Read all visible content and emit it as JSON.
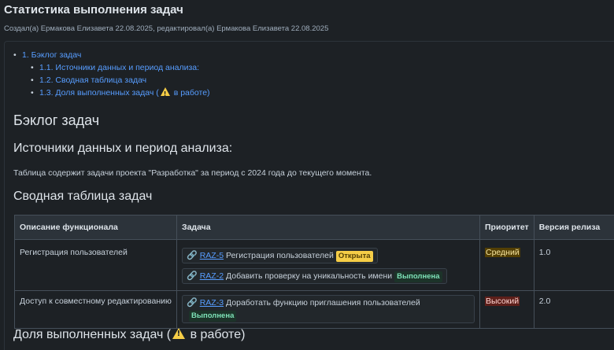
{
  "page": {
    "title": "Статистика выполнения задач",
    "meta": "Создал(а) Ермакова Елизавета 22.08.2025, редактировал(а) Ермакова Елизавета 22.08.2025"
  },
  "toc": {
    "main": "1. Бэклог задач",
    "items": [
      "1.1. Источники данных и период анализа:",
      "1.2. Сводная таблица задач",
      "1.3. Доля выполненных задач ("
    ],
    "item3_suffix": "в работе)"
  },
  "headings": {
    "backlog": "Бэклог задач",
    "sources": "Источники данных и период анализа:",
    "summary": "Сводная таблица задач",
    "share_prefix": "Доля выполненных задач (",
    "share_suffix": "в работе)"
  },
  "paragraph": "Таблица содержит задачи проекта \"Разработка\" за период с 2024 года до текущего момента.",
  "table": {
    "headers": [
      "Описание функционала",
      "Задача",
      "Приоритет",
      "Версия релиза"
    ],
    "rows": [
      {
        "description": "Регистрация пользователей",
        "tasks": [
          {
            "key": "RAZ-5",
            "title": "Регистрация пользователей",
            "status": "Открыта"
          },
          {
            "key": "RAZ-2",
            "title": "Добавить проверку на уникальность имени",
            "status": "Выполнена"
          }
        ],
        "priority": "Средний",
        "version": "1.0"
      },
      {
        "description": "Доступ к совместному редактированию",
        "tasks": [
          {
            "key": "RAZ-3",
            "title": "Доработать функцию приглашения пользователей",
            "status": "Выполнена"
          }
        ],
        "priority": "Высокий",
        "version": "2.0"
      }
    ]
  },
  "icons": {
    "warning": "warning-icon",
    "link": "link-icon"
  },
  "colors": {
    "background": "#1d2125",
    "link": "#579dff",
    "status_open": "#f5cd47",
    "status_done": "#1c3329",
    "priority_medium": "#533f04",
    "priority_high": "#5d1f1a"
  }
}
